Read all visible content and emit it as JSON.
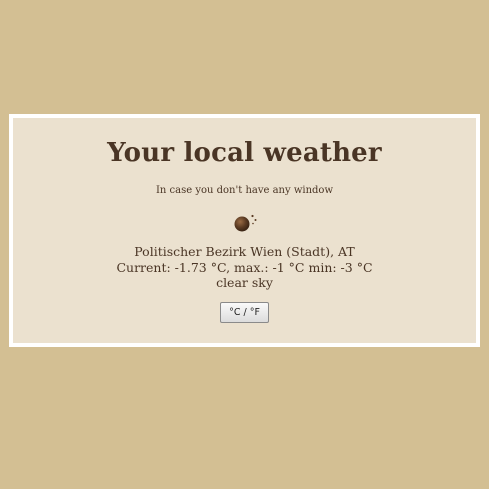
{
  "header": {
    "title": "Your local weather",
    "subtitle": "In case you don't have any window"
  },
  "weather": {
    "icon": "moon-night-icon",
    "location": "Politischer Bezirk Wien (Stadt), AT",
    "current": "Current: -1.73 °C, max.: -1 °C min: -3 °C",
    "description": "clear sky"
  },
  "controls": {
    "unit_toggle_label": "°C / °F"
  },
  "colors": {
    "page_background": "#d3bf93",
    "card_background": "#ebe1cf",
    "card_border": "#ffffff",
    "text": "#4a3525"
  }
}
